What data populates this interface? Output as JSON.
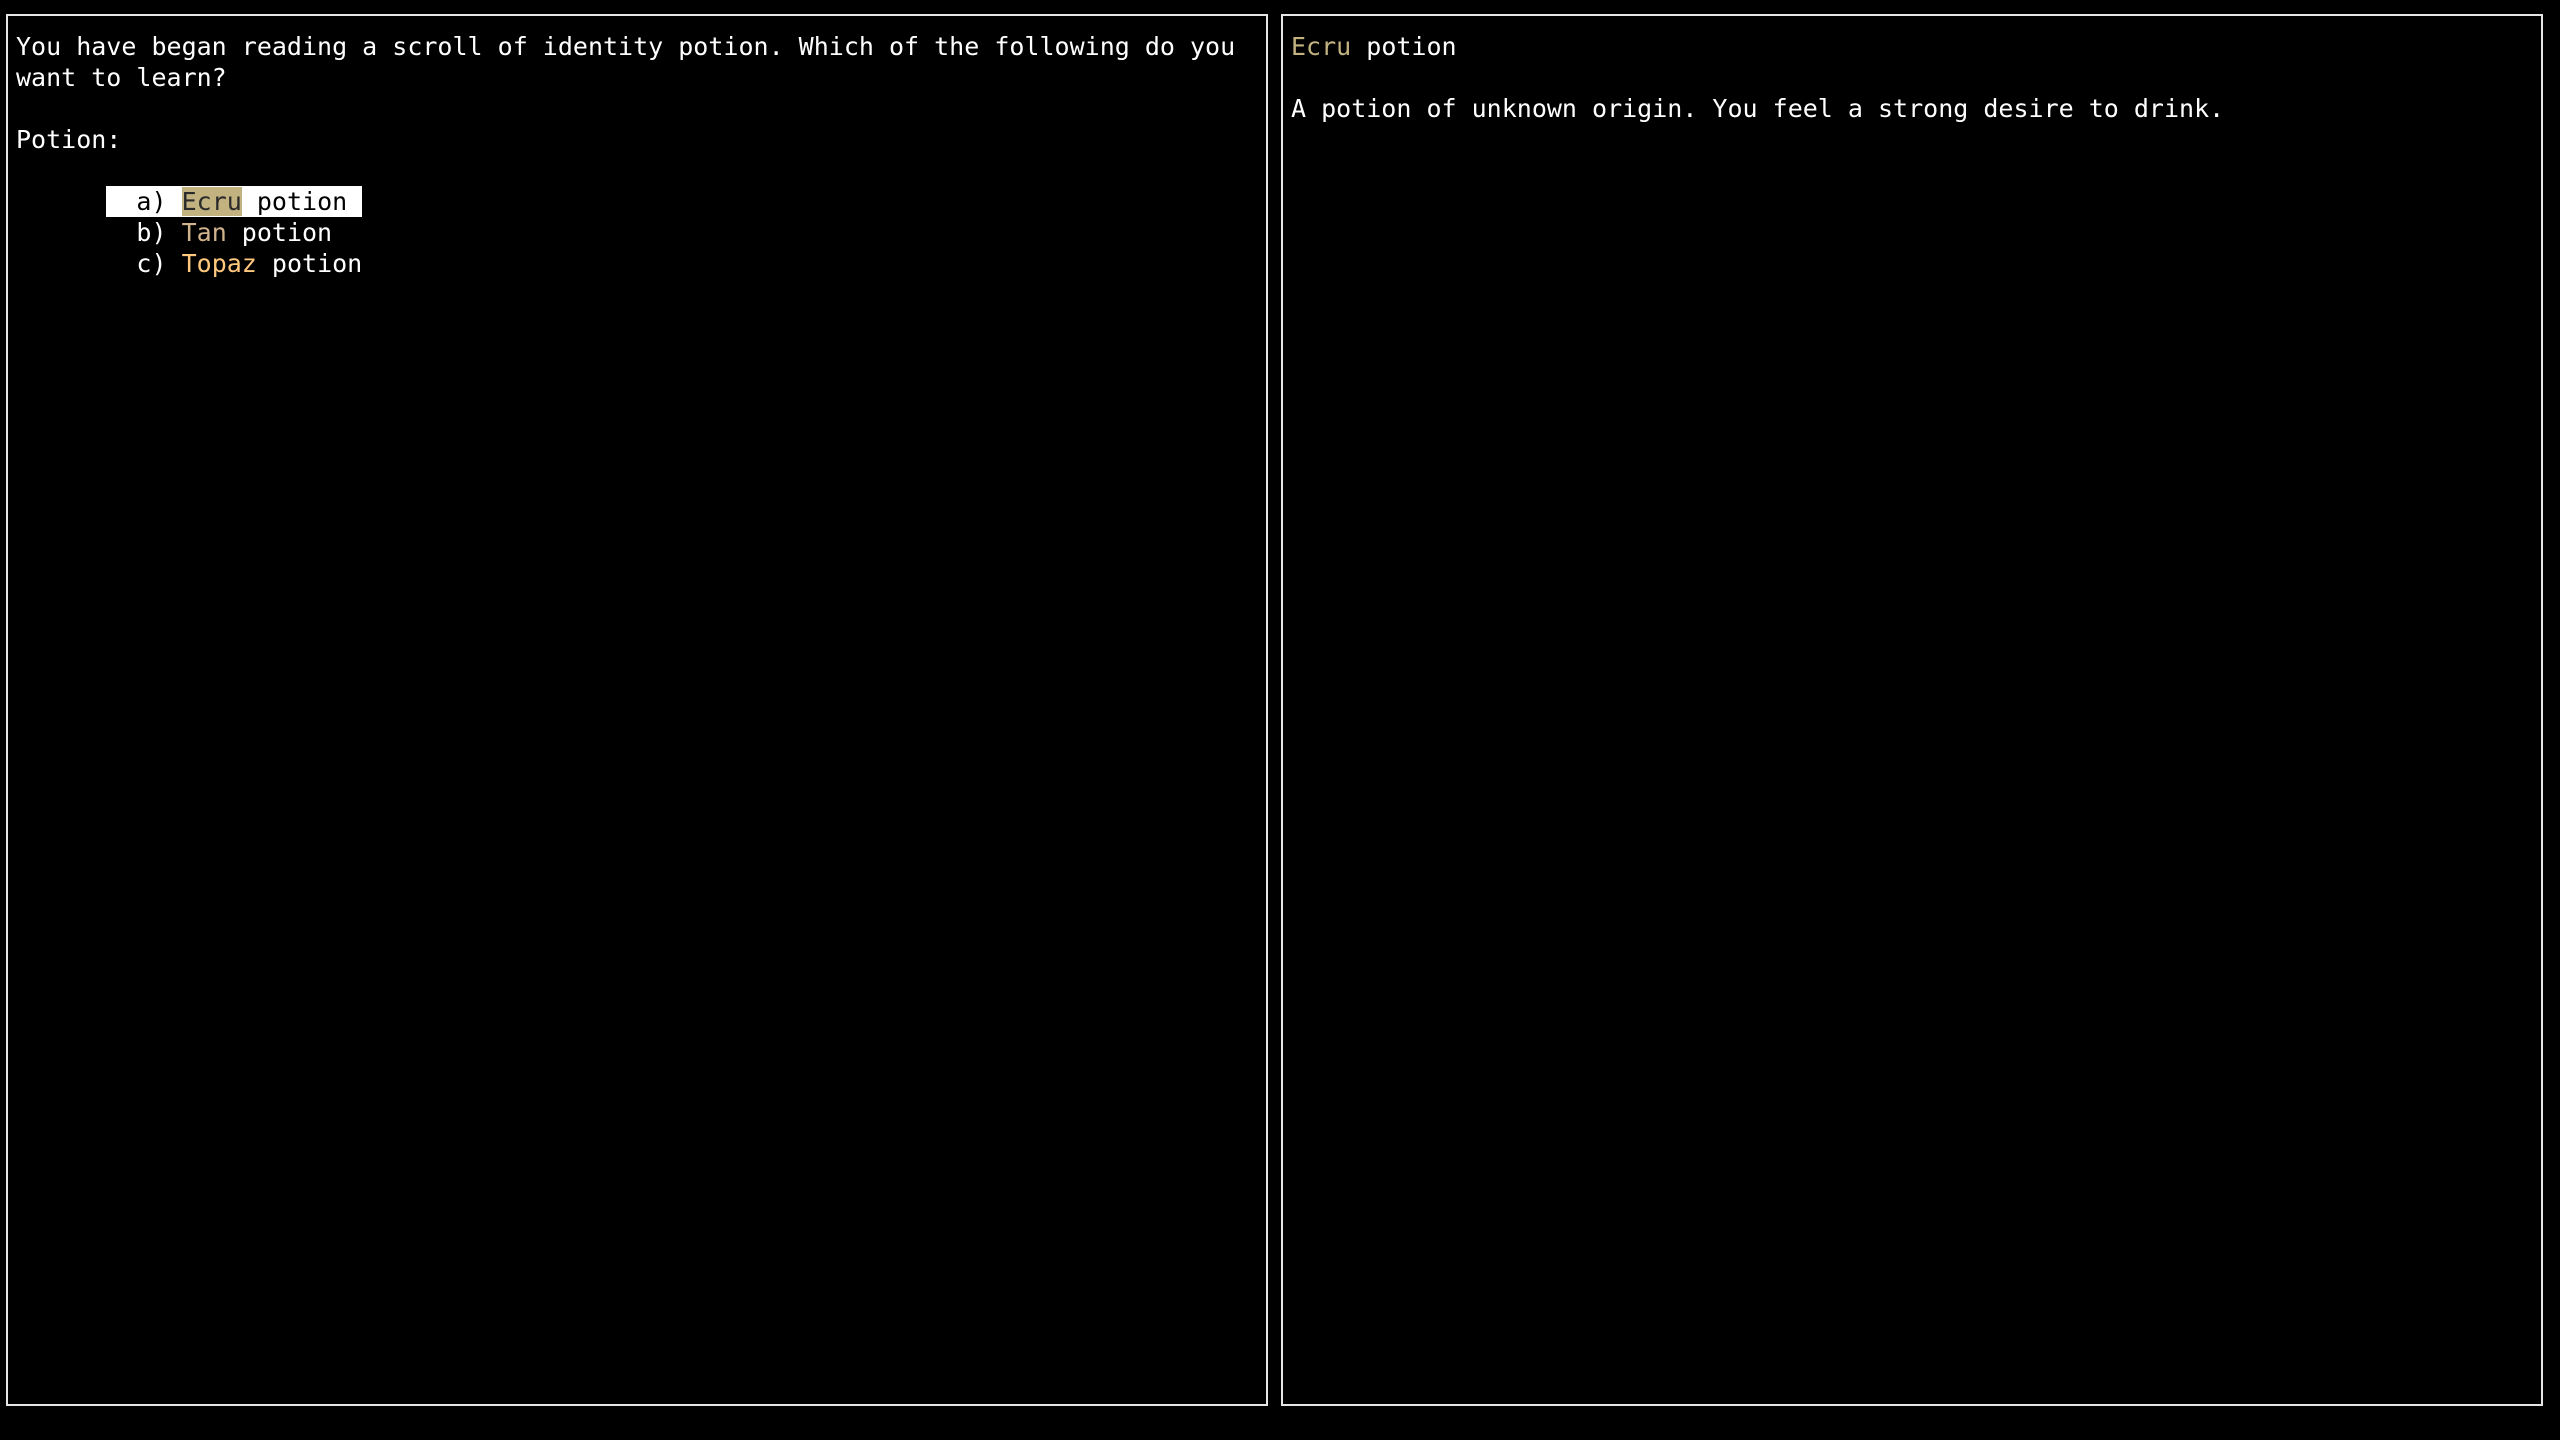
{
  "left_panel": {
    "prompt_lines": [
      "You have began reading a scroll of identity potion. Which of the following do you",
      "want to learn?"
    ],
    "section_label": "Potion:",
    "items": [
      {
        "key": "a)",
        "color_word": "Ecru",
        "color": "#c2b280",
        "suffix": " potion",
        "selected": true
      },
      {
        "key": "b)",
        "color_word": "Tan",
        "color": "#d2b48c",
        "suffix": " potion",
        "selected": false
      },
      {
        "key": "c)",
        "color_word": "Topaz",
        "color": "#ffc87c",
        "suffix": " potion",
        "selected": false
      }
    ]
  },
  "right_panel": {
    "title_color_word": "Ecru",
    "title_color": "#c2b280",
    "title_suffix": " potion",
    "description": "A potion of unknown origin. You feel a strong desire to drink."
  },
  "colors": {
    "background": "#000000",
    "border": "#e6e6e6",
    "text": "#ffffff",
    "selection_bg": "#ffffff"
  }
}
